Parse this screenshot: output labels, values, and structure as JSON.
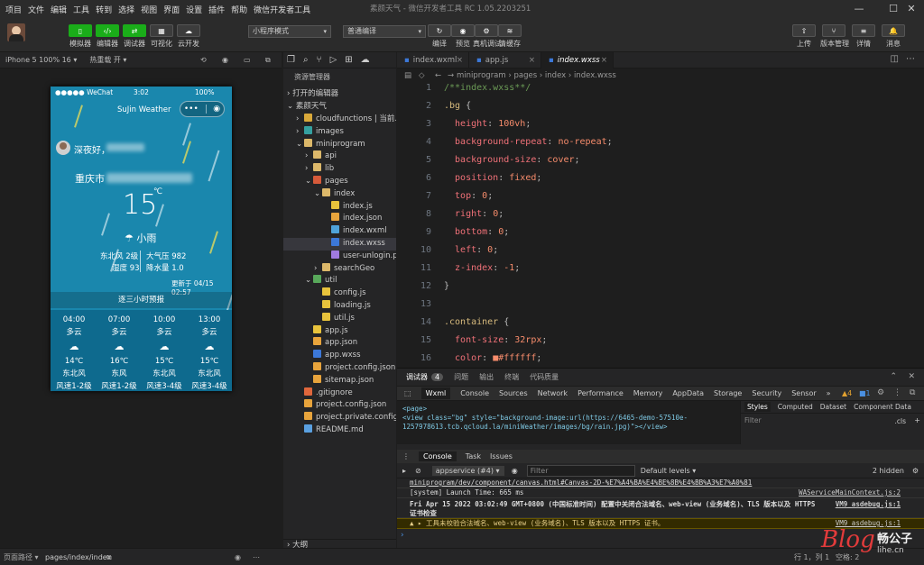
{
  "menu": [
    "项目",
    "文件",
    "编辑",
    "工具",
    "转到",
    "选择",
    "视图",
    "界面",
    "设置",
    "插件",
    "帮助",
    "微信开发者工具"
  ],
  "window_title": "素颜天气",
  "window_subtitle": "- 微信开发者工具 RC 1.05.2203251",
  "toolbar": {
    "left_buttons": [
      {
        "label": "模拟器",
        "glyph": "▯"
      },
      {
        "label": "编辑器",
        "glyph": "‹/›"
      },
      {
        "label": "调试器",
        "glyph": "⇄"
      },
      {
        "label": "可视化",
        "glyph": "▦"
      },
      {
        "label": "云开发",
        "glyph": "☁"
      }
    ],
    "mode_select": "小程序模式",
    "compile_select": "普通编译",
    "mid_buttons": [
      {
        "label": "编译",
        "glyph": "↻"
      },
      {
        "label": "预览",
        "glyph": "◉"
      },
      {
        "label": "真机调试",
        "glyph": "⚙"
      },
      {
        "label": "清缓存",
        "glyph": "≋"
      }
    ],
    "right_buttons": [
      {
        "label": "上传",
        "glyph": "⇧"
      },
      {
        "label": "版本管理",
        "glyph": "⑂"
      },
      {
        "label": "详情",
        "glyph": "≡"
      },
      {
        "label": "消息",
        "glyph": "🔔"
      }
    ]
  },
  "sim_bar": {
    "device": "iPhone 5 100% 16 ▾",
    "hotreload": "热重载 开 ▾"
  },
  "phone": {
    "signal": "●●●●● WeChat",
    "time": "3:02",
    "battery": "100%",
    "nav_title": "SuJin Weather",
    "capsule_more": "•••",
    "capsule_close": "◉",
    "greeting": "深夜好，",
    "city": "重庆市",
    "temperature": "15",
    "unit": "℃",
    "weather": "小雨",
    "wind_dir": "东北风 2级",
    "pressure": "大气压 982",
    "humidity": "湿度 93",
    "rainfall": "降水量 1.0",
    "updated": "更新于 04/15 02:57",
    "forecast_title": "逐三小时预报",
    "forecast": [
      {
        "time": "04:00",
        "cond": "多云",
        "temp": "14℃",
        "wind": "东北风",
        "level": "风速1-2级"
      },
      {
        "time": "07:00",
        "cond": "多云",
        "temp": "16℃",
        "wind": "东风",
        "level": "风速1-2级"
      },
      {
        "time": "10:00",
        "cond": "多云",
        "temp": "15℃",
        "wind": "东北风",
        "level": "风速3-4级"
      },
      {
        "time": "13:00",
        "cond": "多云",
        "temp": "15℃",
        "wind": "东北风",
        "level": "风速3-4级"
      }
    ]
  },
  "explorer": {
    "header": "资源管理器",
    "open_editors": "打开的编辑器",
    "project": "素颜天气",
    "tree": [
      {
        "label": "cloudfunctions | 当前...",
        "indent": 1,
        "kind": "folder-cloud",
        "arrow": "›"
      },
      {
        "label": "images",
        "indent": 1,
        "kind": "folder-img",
        "arrow": "›"
      },
      {
        "label": "miniprogram",
        "indent": 1,
        "kind": "folder",
        "arrow": "⌄"
      },
      {
        "label": "api",
        "indent": 2,
        "kind": "folder",
        "arrow": "›"
      },
      {
        "label": "lib",
        "indent": 2,
        "kind": "folder",
        "arrow": "›"
      },
      {
        "label": "pages",
        "indent": 2,
        "kind": "folder-red",
        "arrow": "⌄"
      },
      {
        "label": "index",
        "indent": 3,
        "kind": "folder",
        "arrow": "⌄"
      },
      {
        "label": "index.js",
        "indent": 4,
        "kind": "js",
        "arrow": ""
      },
      {
        "label": "index.json",
        "indent": 4,
        "kind": "json",
        "arrow": ""
      },
      {
        "label": "index.wxml",
        "indent": 4,
        "kind": "wxml",
        "arrow": ""
      },
      {
        "label": "index.wxss",
        "indent": 4,
        "kind": "wxss",
        "arrow": "",
        "selected": true
      },
      {
        "label": "user-unlogin.png",
        "indent": 4,
        "kind": "png",
        "arrow": ""
      },
      {
        "label": "searchGeo",
        "indent": 3,
        "kind": "folder",
        "arrow": "›"
      },
      {
        "label": "util",
        "indent": 2,
        "kind": "folder-green",
        "arrow": "⌄"
      },
      {
        "label": "config.js",
        "indent": 3,
        "kind": "js",
        "arrow": ""
      },
      {
        "label": "loading.js",
        "indent": 3,
        "kind": "js",
        "arrow": ""
      },
      {
        "label": "util.js",
        "indent": 3,
        "kind": "js",
        "arrow": ""
      },
      {
        "label": "app.js",
        "indent": 2,
        "kind": "js",
        "arrow": ""
      },
      {
        "label": "app.json",
        "indent": 2,
        "kind": "json",
        "arrow": ""
      },
      {
        "label": "app.wxss",
        "indent": 2,
        "kind": "wxss",
        "arrow": ""
      },
      {
        "label": "project.config.json",
        "indent": 2,
        "kind": "json",
        "arrow": ""
      },
      {
        "label": "sitemap.json",
        "indent": 2,
        "kind": "json",
        "arrow": ""
      },
      {
        "label": ".gitignore",
        "indent": 1,
        "kind": "git",
        "arrow": ""
      },
      {
        "label": "project.config.json",
        "indent": 1,
        "kind": "json",
        "arrow": ""
      },
      {
        "label": "project.private.config.js...",
        "indent": 1,
        "kind": "json",
        "arrow": ""
      },
      {
        "label": "README.md",
        "indent": 1,
        "kind": "md",
        "arrow": ""
      }
    ],
    "outline": "大纲"
  },
  "editor": {
    "tabs": [
      {
        "label": "index.wxml",
        "active": false
      },
      {
        "label": "app.js",
        "active": false
      },
      {
        "label": "index.wxss",
        "active": true
      }
    ],
    "breadcrumb": "miniprogram › pages › index › index.wxss",
    "lines": [
      {
        "n": "1",
        "parts": [
          [
            "cm",
            "/**index.wxss**/"
          ]
        ]
      },
      {
        "n": "2",
        "parts": [
          [
            "sel-c",
            ".bg"
          ],
          [
            "pun",
            " {"
          ]
        ]
      },
      {
        "n": "3",
        "parts": [
          [
            "prop",
            "  height"
          ],
          [
            "pun",
            ": "
          ],
          [
            "val",
            "100vh"
          ],
          [
            "pun",
            ";"
          ]
        ]
      },
      {
        "n": "4",
        "parts": [
          [
            "prop",
            "  background-repeat"
          ],
          [
            "pun",
            ": "
          ],
          [
            "val",
            "no-repeat"
          ],
          [
            "pun",
            ";"
          ]
        ]
      },
      {
        "n": "5",
        "parts": [
          [
            "prop",
            "  background-size"
          ],
          [
            "pun",
            ": "
          ],
          [
            "val",
            "cover"
          ],
          [
            "pun",
            ";"
          ]
        ]
      },
      {
        "n": "6",
        "parts": [
          [
            "prop",
            "  position"
          ],
          [
            "pun",
            ": "
          ],
          [
            "val",
            "fixed"
          ],
          [
            "pun",
            ";"
          ]
        ]
      },
      {
        "n": "7",
        "parts": [
          [
            "prop",
            "  top"
          ],
          [
            "pun",
            ": "
          ],
          [
            "val",
            "0"
          ],
          [
            "pun",
            ";"
          ]
        ]
      },
      {
        "n": "8",
        "parts": [
          [
            "prop",
            "  right"
          ],
          [
            "pun",
            ": "
          ],
          [
            "val",
            "0"
          ],
          [
            "pun",
            ";"
          ]
        ]
      },
      {
        "n": "9",
        "parts": [
          [
            "prop",
            "  bottom"
          ],
          [
            "pun",
            ": "
          ],
          [
            "val",
            "0"
          ],
          [
            "pun",
            ";"
          ]
        ]
      },
      {
        "n": "10",
        "parts": [
          [
            "prop",
            "  left"
          ],
          [
            "pun",
            ": "
          ],
          [
            "val",
            "0"
          ],
          [
            "pun",
            ";"
          ]
        ]
      },
      {
        "n": "11",
        "parts": [
          [
            "prop",
            "  z-index"
          ],
          [
            "pun",
            ": "
          ],
          [
            "val",
            "-1"
          ],
          [
            "pun",
            ";"
          ]
        ]
      },
      {
        "n": "12",
        "parts": [
          [
            "pun",
            "}"
          ]
        ]
      },
      {
        "n": "13",
        "parts": []
      },
      {
        "n": "14",
        "parts": [
          [
            "sel-c",
            ".container"
          ],
          [
            "pun",
            " {"
          ]
        ]
      },
      {
        "n": "15",
        "parts": [
          [
            "prop",
            "  font-size"
          ],
          [
            "pun",
            ": "
          ],
          [
            "val",
            "32rpx"
          ],
          [
            "pun",
            ";"
          ]
        ]
      },
      {
        "n": "16",
        "parts": [
          [
            "prop",
            "  color"
          ],
          [
            "pun",
            ": "
          ],
          [
            "val",
            "■#ffffff"
          ],
          [
            "pun",
            ";"
          ]
        ]
      }
    ]
  },
  "debug": {
    "tabs": [
      "调试器",
      "问题",
      "输出",
      "终端",
      "代码质量"
    ],
    "badge": "4",
    "devtools_tabs": [
      "Wxml",
      "Console",
      "Sources",
      "Network",
      "Performance",
      "Memory",
      "AppData",
      "Storage",
      "Security",
      "Sensor"
    ],
    "warn_count": "▲4",
    "info_count": "■1",
    "wxml_lines": [
      "<page>",
      "  <view class=\"bg\" style=\"background-image:url(https://6465-demo-57510e-1257978613.tcb.qcloud.la/miniWeather/images/bg/rain.jpg)\"></view>"
    ],
    "style_tabs": [
      "Styles",
      "Computed",
      "Dataset",
      "Component Data"
    ],
    "filter_placeholder": "Filter",
    "cls": ".cls",
    "console_tabs": [
      "Console",
      "Task",
      "Issues"
    ],
    "context": "appservice (#4)",
    "levels": "Default levels ▾",
    "hidden": "2 hidden",
    "logs": [
      {
        "text": "miniprogram/dev/component/canvas.html#Canvas-2D-%E7%A4%BA%E4%BE%8B%E4%BB%A3%E7%A0%81",
        "src": "",
        "kind": "link"
      },
      {
        "text": "[system] Launch Time: 665 ms",
        "src": "WAServiceMainContext.js:2",
        "kind": "plain"
      },
      {
        "text": "Fri Apr 15 2022 03:02:49 GMT+0800 (中国标准时间) 配置中关闭合法域名、web-view (业务域名)、TLS 版本以及 HTTPS 证书检查",
        "src": "VM9_asdebug.js:1",
        "kind": "bold"
      },
      {
        "text": "▲ ▸ 工具未校验合法域名、web-view (业务域名)、TLS 版本以及 HTTPS 证书。",
        "src": "VM9_asdebug.js:1",
        "kind": "warn"
      }
    ],
    "prompt": "›"
  },
  "status": {
    "page_path_label": "页面路径 ▾",
    "page_path": "pages/index/index",
    "cursor": "行 1，列 1",
    "spaces": "空格: 2",
    "encoding": "UTF-8"
  },
  "watermark": "Blog | 畅公子 lihe.cn",
  "colors": {
    "accent_green": "#1aad19",
    "phone_bg": "#1a87ad",
    "selection": "#37373d"
  }
}
